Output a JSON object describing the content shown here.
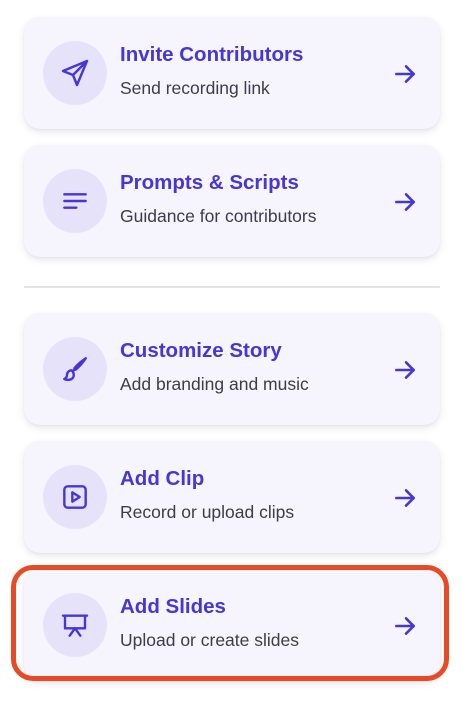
{
  "colors": {
    "accent": "#4636d6",
    "card_background": "#f6f4fd",
    "icon_background": "#e6e2fa",
    "subtitle_text": "#3d3d47",
    "divider": "#e4e3ea",
    "highlight_border": "#e84a26"
  },
  "actions": [
    {
      "title": "Invite Contributors",
      "subtitle": "Send recording link",
      "icon": "send-icon"
    },
    {
      "title": "Prompts & Scripts",
      "subtitle": "Guidance for contributors",
      "icon": "lines-icon"
    },
    {
      "title": "Customize Story",
      "subtitle": "Add branding and music",
      "icon": "brush-icon"
    },
    {
      "title": "Add Clip",
      "subtitle": "Record or upload clips",
      "icon": "play-icon"
    },
    {
      "title": "Add Slides",
      "subtitle": "Upload or create slides",
      "icon": "presentation-icon",
      "highlighted": true
    }
  ]
}
